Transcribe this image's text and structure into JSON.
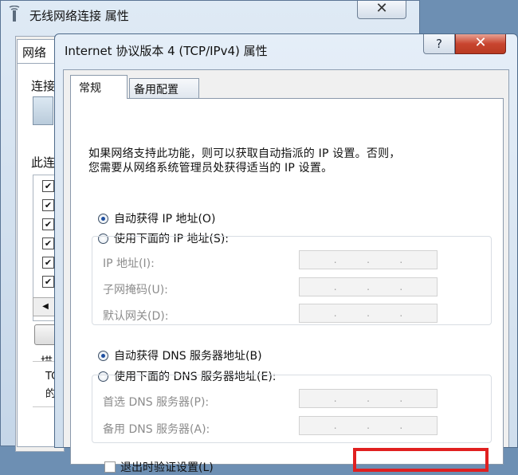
{
  "back_window": {
    "title": "无线网络连接 属性",
    "close_label": "✕",
    "tab_label": "网络",
    "connect_label": "连接",
    "this_connection_label": "此连",
    "scroll_left": "◀",
    "checks": [
      "✔",
      "✔",
      "✔",
      "✔",
      "✔",
      "✔"
    ],
    "description_label": "描",
    "desc_line1": "TC",
    "desc_line2": "的"
  },
  "dialog": {
    "title": "Internet 协议版本 4 (TCP/IPv4) 属性",
    "help_label": "?",
    "close_label": "✕",
    "tabs": [
      {
        "label": "常规",
        "active": true
      },
      {
        "label": "备用配置",
        "active": false
      }
    ],
    "intro_line1": "如果网络支持此功能，则可以获取自动指派的 IP 设置。否则，",
    "intro_line2": "您需要从网络系统管理员处获得适当的 IP 设置。",
    "ip": {
      "auto_option": "自动获得 IP 地址(O)",
      "manual_option": "使用下面的 IP 地址(S):",
      "selected": "auto",
      "fields": [
        {
          "label": "IP 地址(I):"
        },
        {
          "label": "子网掩码(U):"
        },
        {
          "label": "默认网关(D):"
        }
      ]
    },
    "dns": {
      "auto_option": "自动获得 DNS 服务器地址(B)",
      "manual_option": "使用下面的 DNS 服务器地址(E):",
      "selected": "auto",
      "fields": [
        {
          "label": "首选 DNS 服务器(P):"
        },
        {
          "label": "备用 DNS 服务器(A):"
        }
      ]
    },
    "ip_dots": [
      ".",
      ".",
      "."
    ],
    "validate_checkbox_label": "退出时验证设置(L)"
  },
  "colors": {
    "highlight_box": "#e02020",
    "close_button": "#c8452f"
  }
}
